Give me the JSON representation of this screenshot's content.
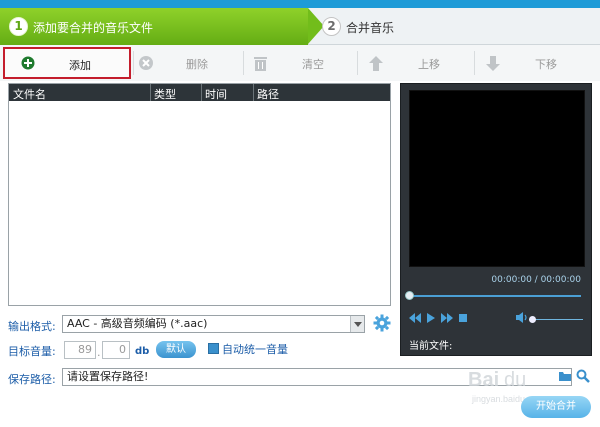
{
  "steps": [
    {
      "num": "1",
      "label": "添加要合并的音乐文件"
    },
    {
      "num": "2",
      "label": "合并音乐"
    }
  ],
  "toolbar": {
    "add": "添加",
    "delete": "删除",
    "clear": "清空",
    "move_up": "上移",
    "move_down": "下移"
  },
  "file_list": {
    "columns": [
      "文件名",
      "类型",
      "时间",
      "路径"
    ],
    "rows": []
  },
  "player": {
    "time": "00:00:00 / 00:00:00",
    "current_file_label": "当前文件:"
  },
  "output": {
    "format_label": "输出格式:",
    "format_value": "AAC - 高级音频编码 (*.aac)",
    "volume_label": "目标音量:",
    "volume_int": "89",
    "volume_dec": "0",
    "volume_unit": "db",
    "default_button": "默认",
    "auto_normalize_label": "自动统一音量",
    "save_path_label": "保存路径:",
    "save_path_value": "请设置保存路径!",
    "start_button": "开始合并"
  },
  "colors": {
    "accent_blue": "#1e9bd7",
    "step_green": "#72bd1b",
    "highlight_red": "#c41d2c"
  }
}
